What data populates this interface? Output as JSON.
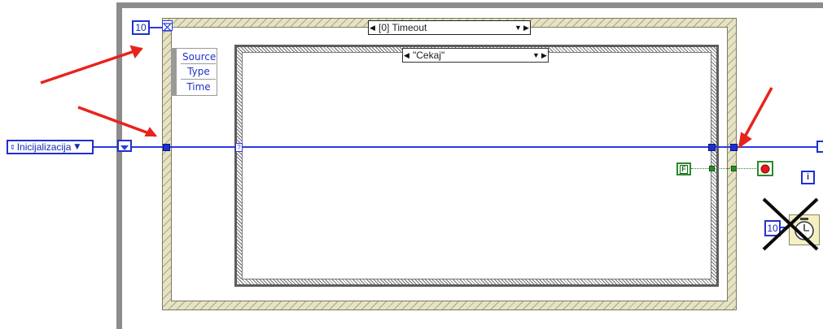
{
  "enum_constant": {
    "label": "Inicijalizacija"
  },
  "loop_count": {
    "value": "10"
  },
  "event_structure": {
    "case_label": "[0] Timeout"
  },
  "event_data_node": {
    "items": [
      "Source",
      "Type",
      "Time"
    ]
  },
  "case_structure": {
    "case_label": "\"Cekaj\""
  },
  "false_constant": {
    "label": "F"
  },
  "wait_constant": {
    "value": "10"
  },
  "tunnel_glyph": "?",
  "iteration_terminal": "i",
  "colors": {
    "wire": "#2a3adf",
    "arrow": "#e8231c",
    "bool": "#2b8a2b"
  }
}
